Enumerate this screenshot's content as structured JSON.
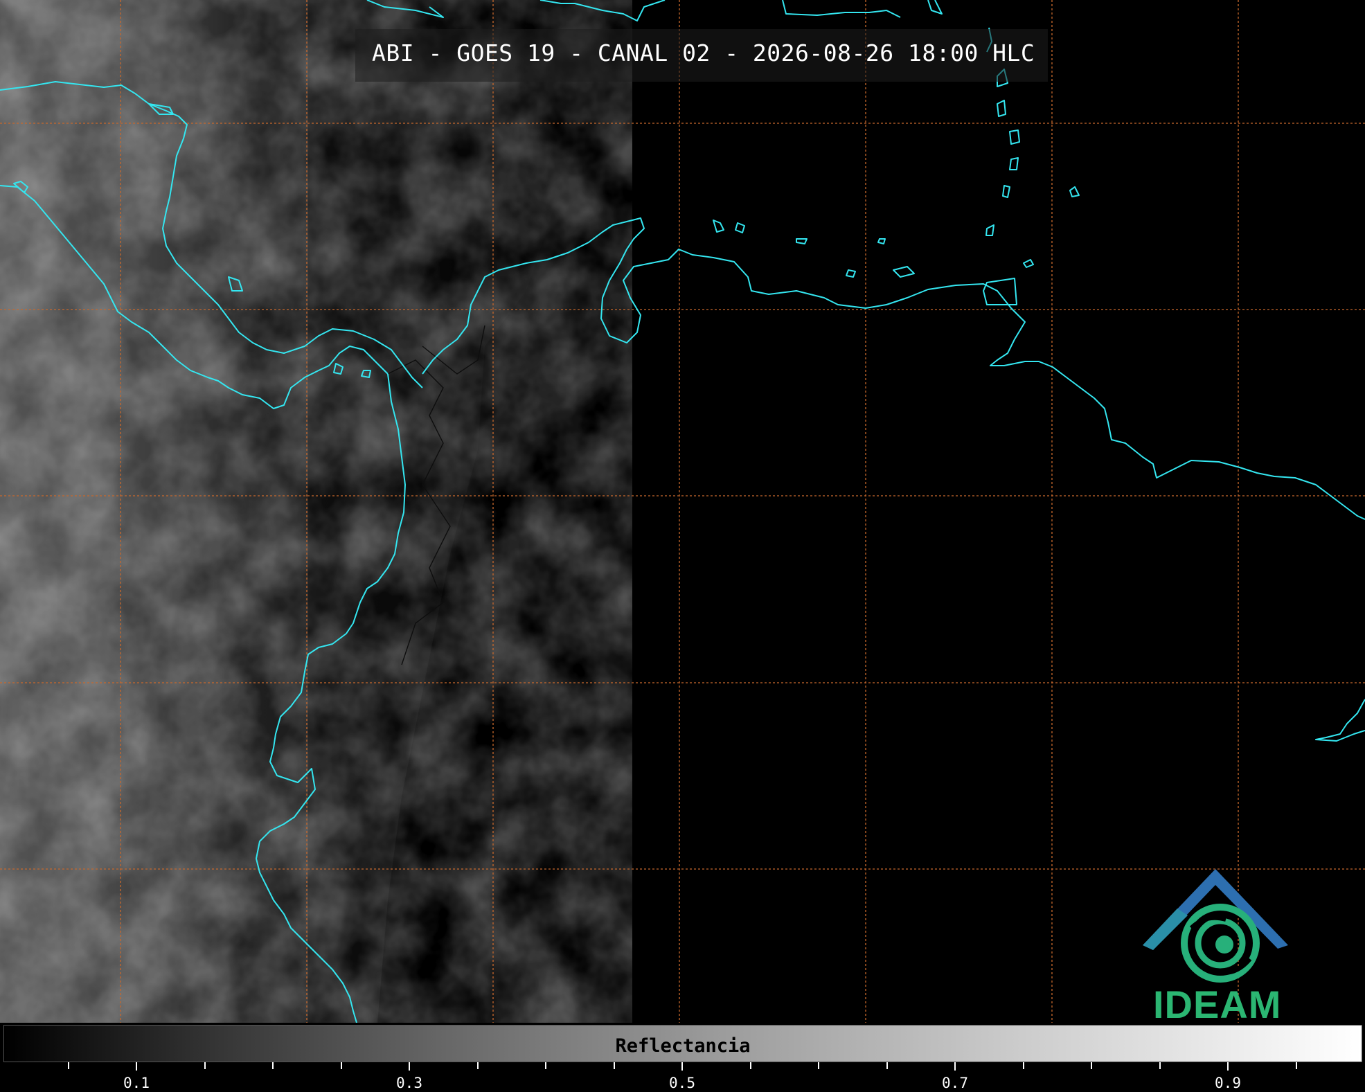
{
  "map": {
    "title": "ABI - GOES 19 - CANAL 02 - 2026-08-26 18:00 HLC",
    "colors": {
      "coastline": "#34e6f0",
      "gridline": "#c8682c",
      "borders": "#101010",
      "background": "#000000"
    }
  },
  "colorbar": {
    "label": "Reflectancia",
    "ticks": [
      "0.1",
      "0.3",
      "0.5",
      "0.7",
      "0.9"
    ]
  },
  "logo": {
    "text": "IDEAM",
    "colors": {
      "roof": "#2d6fb0",
      "swirl": "#27b07a"
    }
  }
}
